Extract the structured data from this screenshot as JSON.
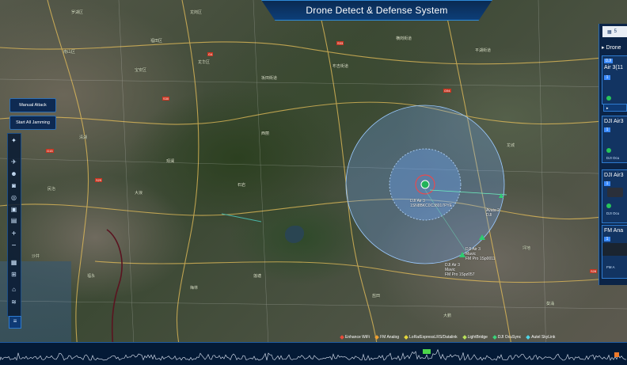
{
  "header": {
    "title": "Drone Detect & Defense System"
  },
  "left_controls": {
    "manual_attack": "Manual Attack",
    "start_all_jamming": "Start All Jamming",
    "tools": [
      "location-icon",
      "plane-icon",
      "user-icon",
      "camera-icon",
      "target-icon",
      "monitor-icon",
      "calendar-icon",
      "plus-icon",
      "minus-icon",
      "grid-icon",
      "layers-map-icon",
      "home-icon",
      "stack-icon",
      "menu-icon"
    ],
    "zoom_in": "+",
    "zoom_out": "−"
  },
  "right_panel": {
    "count_label": "5",
    "section_title": "Drone",
    "cards": [
      {
        "title": "Air 3(11",
        "badge": "1",
        "tag": "DJI"
      },
      {
        "title": "DJI Air3",
        "badge": "1",
        "sub": "DJI Ocu"
      },
      {
        "title": "DJI Air3",
        "badge": "1",
        "sub": "DJI Ocu"
      },
      {
        "title": "FM Ana",
        "badge": "1",
        "sub": "FM A"
      }
    ]
  },
  "drones": [
    {
      "label": "DJI Air 3\n1SN8BKC0C38017PYE"
    },
    {
      "label": "Avata 2\nDJI"
    },
    {
      "label": "DJI Air 3\nMavic\nFM Pro 1Sp0011"
    },
    {
      "label": "DJI Air 3\nMavic\nFM Pro 1Spz057"
    }
  ],
  "legend": [
    {
      "label": "Enhance WiFi",
      "color": "#e84b3a"
    },
    {
      "label": "FM Analog",
      "color": "#f0a030"
    },
    {
      "label": "LoRa/ExpressLRS/Datalink",
      "color": "#e6d83a"
    },
    {
      "label": "LightBridge",
      "color": "#b8e05a"
    },
    {
      "label": "DJI OcuSync",
      "color": "#3ad27a"
    },
    {
      "label": "Autel SkyLink",
      "color": "#4fd6e8"
    }
  ],
  "map_labels": [
    "罗湖区",
    "龙岗区",
    "南山区",
    "福田区",
    "宝安区",
    "龙华区",
    "坂田街道",
    "布吉街道",
    "横岗街道",
    "平湖街道",
    "清湖",
    "观澜",
    "民治",
    "大浪",
    "石岩",
    "西丽",
    "沙井",
    "福永",
    "梅林",
    "莲塘",
    "盐田",
    "龙城",
    "坪地",
    "葵涌",
    "大鹏"
  ],
  "highway_labels": [
    "G4",
    "S33",
    "G15",
    "S29",
    "G94",
    "S28",
    "S30"
  ],
  "colors": {
    "accent": "#2e8bd8",
    "panel": "#0b2447",
    "range": "#5aa8ff"
  }
}
